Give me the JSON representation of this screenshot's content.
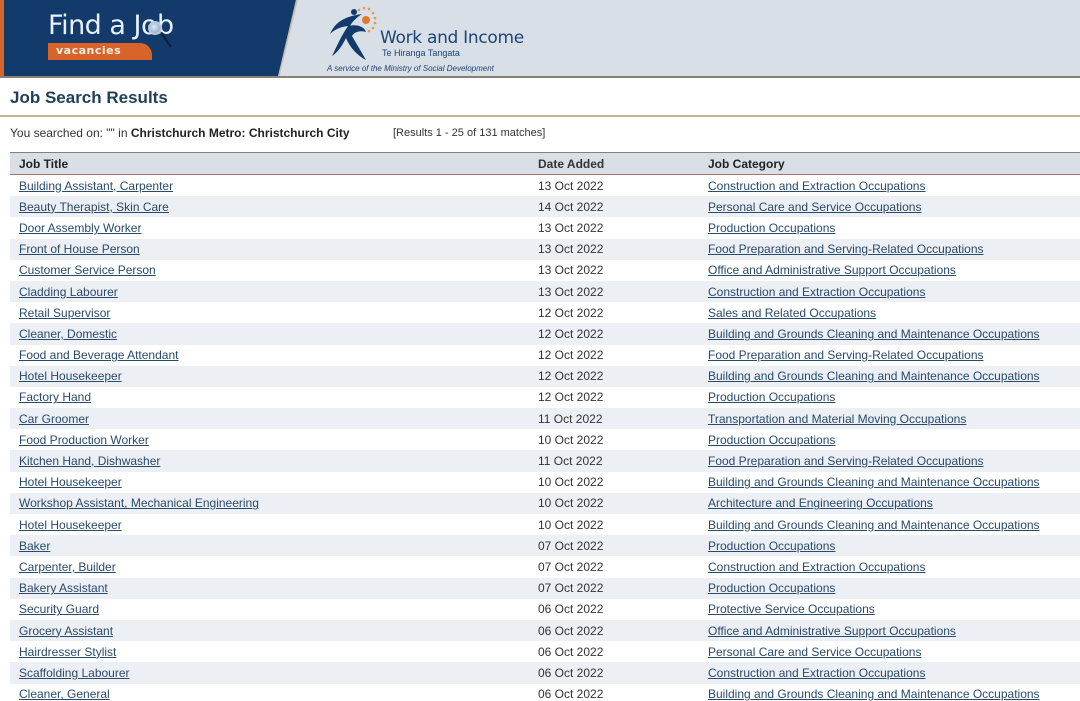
{
  "header": {
    "find_a_job": "Find a Job",
    "vacancies": "vacancies",
    "org_name": "Work and Income",
    "org_maori": "Te Hiranga Tangata",
    "org_service": "A service of the Ministry of Social Development"
  },
  "page": {
    "title": "Job Search Results",
    "search_prefix": "You searched on: \"\" in ",
    "search_location": "Christchurch Metro: Christchurch City",
    "results_count": "[Results 1 - 25 of 131 matches]"
  },
  "table": {
    "headers": {
      "title": "Job Title",
      "date": "Date Added",
      "category": "Job Category"
    },
    "rows": [
      {
        "title": "Building Assistant, Carpenter",
        "date": "13 Oct 2022",
        "category": "Construction and Extraction Occupations"
      },
      {
        "title": "Beauty Therapist, Skin Care",
        "date": "14 Oct 2022",
        "category": "Personal Care and Service Occupations"
      },
      {
        "title": "Door Assembly Worker",
        "date": "13 Oct 2022",
        "category": "Production Occupations"
      },
      {
        "title": "Front of House Person",
        "date": "13 Oct 2022",
        "category": "Food Preparation and Serving-Related Occupations"
      },
      {
        "title": "Customer Service Person",
        "date": "13 Oct 2022",
        "category": "Office and Administrative Support Occupations"
      },
      {
        "title": "Cladding Labourer",
        "date": "13 Oct 2022",
        "category": "Construction and Extraction Occupations"
      },
      {
        "title": "Retail Supervisor",
        "date": "12 Oct 2022",
        "category": "Sales and Related Occupations"
      },
      {
        "title": "Cleaner, Domestic",
        "date": "12 Oct 2022",
        "category": "Building and Grounds Cleaning and Maintenance Occupations"
      },
      {
        "title": "Food and Beverage Attendant",
        "date": "12 Oct 2022",
        "category": "Food Preparation and Serving-Related Occupations"
      },
      {
        "title": "Hotel Housekeeper",
        "date": "12 Oct 2022",
        "category": "Building and Grounds Cleaning and Maintenance Occupations"
      },
      {
        "title": "Factory Hand",
        "date": "12 Oct 2022",
        "category": "Production Occupations"
      },
      {
        "title": "Car Groomer",
        "date": "11 Oct 2022",
        "category": "Transportation and Material Moving Occupations"
      },
      {
        "title": "Food Production Worker",
        "date": "10 Oct 2022",
        "category": "Production Occupations"
      },
      {
        "title": "Kitchen Hand, Dishwasher",
        "date": "11 Oct 2022",
        "category": "Food Preparation and Serving-Related Occupations"
      },
      {
        "title": "Hotel Housekeeper",
        "date": "10 Oct 2022",
        "category": "Building and Grounds Cleaning and Maintenance Occupations"
      },
      {
        "title": "Workshop Assistant, Mechanical Engineering",
        "date": "10 Oct 2022",
        "category": "Architecture and Engineering Occupations"
      },
      {
        "title": "Hotel Housekeeper",
        "date": "10 Oct 2022",
        "category": "Building and Grounds Cleaning and Maintenance Occupations"
      },
      {
        "title": "Baker",
        "date": "07 Oct 2022",
        "category": "Production Occupations"
      },
      {
        "title": "Carpenter, Builder",
        "date": "07 Oct 2022",
        "category": "Construction and Extraction Occupations"
      },
      {
        "title": "Bakery Assistant",
        "date": "07 Oct 2022",
        "category": "Production Occupations"
      },
      {
        "title": "Security Guard",
        "date": "06 Oct 2022",
        "category": "Protective Service Occupations"
      },
      {
        "title": "Grocery Assistant",
        "date": "06 Oct 2022",
        "category": "Office and Administrative Support Occupations"
      },
      {
        "title": "Hairdresser Stylist",
        "date": "06 Oct 2022",
        "category": "Personal Care and Service Occupations"
      },
      {
        "title": "Scaffolding Labourer",
        "date": "06 Oct 2022",
        "category": "Construction and Extraction Occupations"
      },
      {
        "title": "Cleaner, General",
        "date": "06 Oct 2022",
        "category": "Building and Grounds Cleaning and Maintenance Occupations"
      }
    ]
  }
}
